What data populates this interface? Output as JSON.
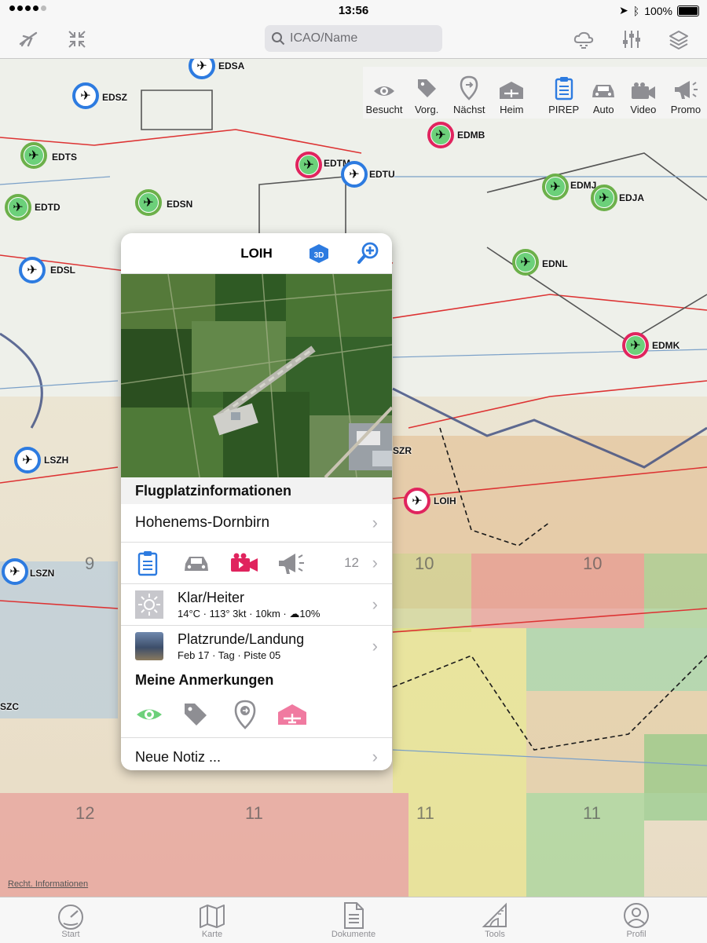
{
  "status_bar": {
    "time": "13:56",
    "battery": "100%"
  },
  "nav": {
    "search_placeholder": "ICAO/Name"
  },
  "quick_actions": [
    {
      "label": "Besucht",
      "icon": "eye-icon"
    },
    {
      "label": "Vorg.",
      "icon": "tag-icon"
    },
    {
      "label": "Nächst",
      "icon": "location-pin-icon"
    },
    {
      "label": "Heim",
      "icon": "hangar-icon"
    },
    {
      "label": "PIREP",
      "icon": "clipboard-icon"
    },
    {
      "label": "Auto",
      "icon": "car-icon"
    },
    {
      "label": "Video",
      "icon": "video-camera-icon"
    },
    {
      "label": "Promo",
      "icon": "megaphone-icon"
    }
  ],
  "map": {
    "airports": [
      {
        "code": "EDSA"
      },
      {
        "code": "EDSZ"
      },
      {
        "code": "EDTS"
      },
      {
        "code": "EDTD"
      },
      {
        "code": "EDSN"
      },
      {
        "code": "EDTM"
      },
      {
        "code": "EDTU"
      },
      {
        "code": "EDMB"
      },
      {
        "code": "EDMJ"
      },
      {
        "code": "EDJA"
      },
      {
        "code": "EDNL"
      },
      {
        "code": "EDMK"
      },
      {
        "code": "EDSL"
      },
      {
        "code": "LSZH"
      },
      {
        "code": "LSZN"
      },
      {
        "code": "LOIH"
      },
      {
        "code": "SZR"
      },
      {
        "code": "SZC"
      }
    ],
    "elevations": [
      "10",
      "10",
      "12",
      "11",
      "11",
      "11",
      "9"
    ],
    "legal_link": "Recht. Informationen"
  },
  "popup": {
    "title": "LOIH",
    "section_info": "Flugplatzinformationen",
    "airport_name": "Hohenems-Dornbirn",
    "media_count": "12",
    "weather": {
      "title": "Klar/Heiter",
      "details": "14°C · 113° 3kt · 10km · ☁10%"
    },
    "pirep": {
      "title": "Platzrunde/Landung",
      "details": "Feb 17 · Tag · Piste 05"
    },
    "section_notes": "Meine Anmerkungen",
    "new_note": "Neue Notiz ..."
  },
  "tabs": [
    {
      "label": "Start",
      "icon": "gauge-icon"
    },
    {
      "label": "Karte",
      "icon": "map-icon"
    },
    {
      "label": "Dokumente",
      "icon": "document-icon"
    },
    {
      "label": "Tools",
      "icon": "ruler-icon"
    },
    {
      "label": "Profil",
      "icon": "person-icon"
    }
  ],
  "colors": {
    "accent": "#2d7be0",
    "video": "#e0245e",
    "visited": "#6cd07a",
    "home": "#f07aa0"
  }
}
